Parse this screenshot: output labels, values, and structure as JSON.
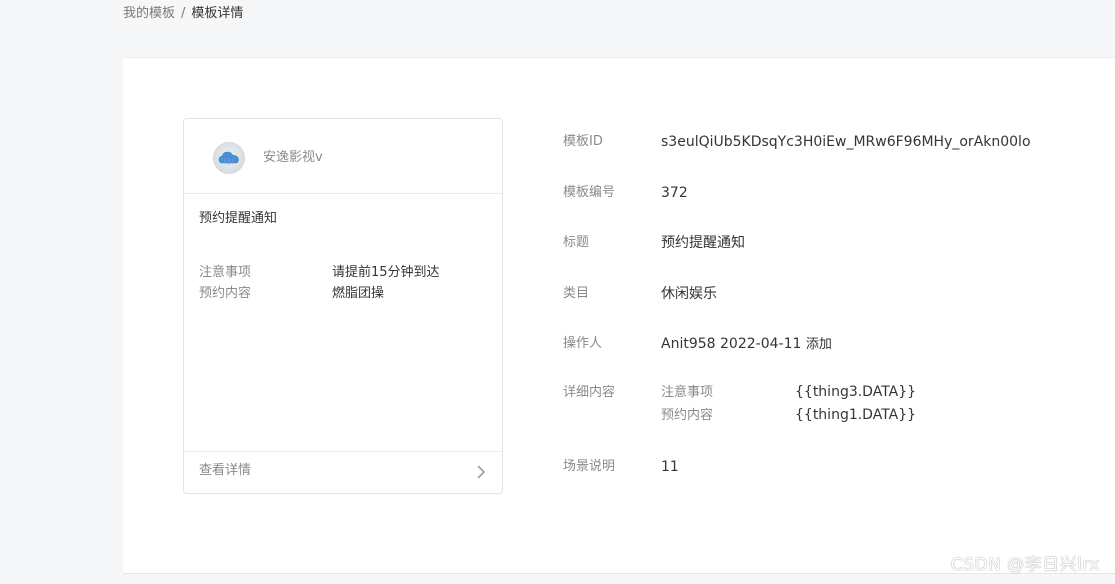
{
  "breadcrumb": {
    "parent": "我的模板",
    "separator": "/",
    "current": "模板详情"
  },
  "preview": {
    "avatar_icon": "cloud-icon",
    "account_name": "安逸影视v",
    "title": "预约提醒通知",
    "fields": [
      {
        "key": "注意事项",
        "value": "请提前15分钟到达"
      },
      {
        "key": "预约内容",
        "value": "燃脂团操"
      }
    ],
    "footer_label": "查看详情",
    "footer_icon": "chevron-right-icon"
  },
  "details": {
    "template_id": {
      "label": "模板ID",
      "value": "s3eulQiUb5KDsqYc3H0iEw_MRw6F96MHy_orAkn00lo"
    },
    "template_no": {
      "label": "模板编号",
      "value": "372"
    },
    "title": {
      "label": "标题",
      "value": "预约提醒通知"
    },
    "category": {
      "label": "类目",
      "value": "休闲娱乐"
    },
    "operator": {
      "label": "操作人",
      "user": "Anit958",
      "date": "2022-04-11",
      "action": "添加"
    },
    "content": {
      "label": "详细内容",
      "items": [
        {
          "key": "注意事项",
          "value": "{{thing3.DATA}}"
        },
        {
          "key": "预约内容",
          "value": "{{thing1.DATA}}"
        }
      ]
    },
    "scene": {
      "label": "场景说明",
      "value": "11"
    }
  },
  "watermark": "CSDN @李日兴lrx"
}
